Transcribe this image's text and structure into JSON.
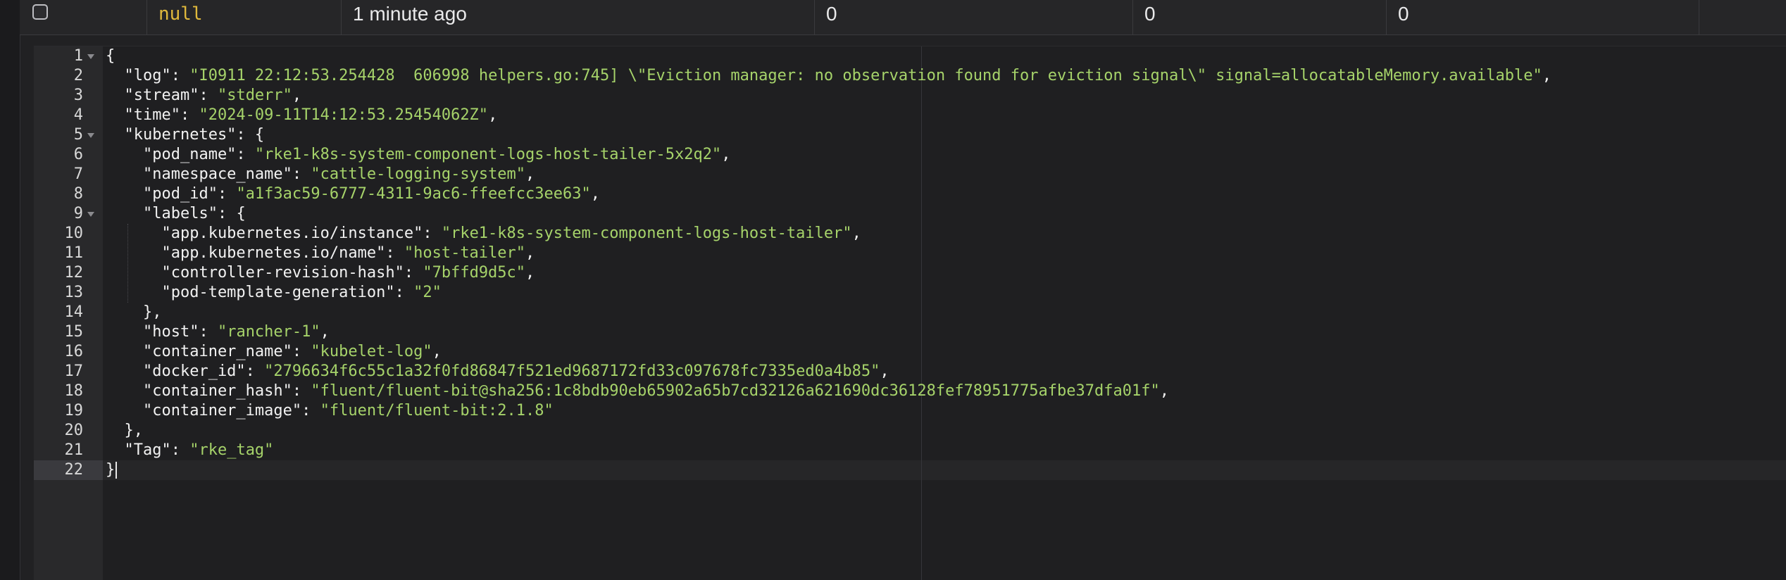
{
  "row": {
    "null_value": "null",
    "time_ago": "1 minute ago",
    "col_a": "0",
    "col_b": "0",
    "col_c": "0"
  },
  "editor": {
    "lines": [
      {
        "num": "1",
        "key": "",
        "punct_pre": "{",
        "value": "",
        "punct_post": ""
      },
      {
        "num": "2",
        "key": "  \"log\": ",
        "punct_pre": "",
        "value": "\"I0911 22:12:53.254428  606998 helpers.go:745] \\\"Eviction manager: no observation found for eviction signal\\\" signal=allocatableMemory.available\"",
        "punct_post": ","
      },
      {
        "num": "3",
        "key": "  \"stream\": ",
        "punct_pre": "",
        "value": "\"stderr\"",
        "punct_post": ","
      },
      {
        "num": "4",
        "key": "  \"time\": ",
        "punct_pre": "",
        "value": "\"2024-09-11T14:12:53.25454062Z\"",
        "punct_post": ","
      },
      {
        "num": "5",
        "key": "  \"kubernetes\": ",
        "punct_pre": "",
        "value": "",
        "punct_post": "{"
      },
      {
        "num": "6",
        "key": "    \"pod_name\": ",
        "punct_pre": "",
        "value": "\"rke1-k8s-system-component-logs-host-tailer-5x2q2\"",
        "punct_post": ","
      },
      {
        "num": "7",
        "key": "    \"namespace_name\": ",
        "punct_pre": "",
        "value": "\"cattle-logging-system\"",
        "punct_post": ","
      },
      {
        "num": "8",
        "key": "    \"pod_id\": ",
        "punct_pre": "",
        "value": "\"a1f3ac59-6777-4311-9ac6-ffeefcc3ee63\"",
        "punct_post": ","
      },
      {
        "num": "9",
        "key": "    \"labels\": ",
        "punct_pre": "",
        "value": "",
        "punct_post": "{"
      },
      {
        "num": "10",
        "key": "      \"app.kubernetes.io/instance\": ",
        "punct_pre": "",
        "value": "\"rke1-k8s-system-component-logs-host-tailer\"",
        "punct_post": ","
      },
      {
        "num": "11",
        "key": "      \"app.kubernetes.io/name\": ",
        "punct_pre": "",
        "value": "\"host-tailer\"",
        "punct_post": ","
      },
      {
        "num": "12",
        "key": "      \"controller-revision-hash\": ",
        "punct_pre": "",
        "value": "\"7bffd9d5c\"",
        "punct_post": ","
      },
      {
        "num": "13",
        "key": "      \"pod-template-generation\": ",
        "punct_pre": "",
        "value": "\"2\"",
        "punct_post": ""
      },
      {
        "num": "14",
        "key": "    ",
        "punct_pre": "",
        "value": "",
        "punct_post": "},"
      },
      {
        "num": "15",
        "key": "    \"host\": ",
        "punct_pre": "",
        "value": "\"rancher-1\"",
        "punct_post": ","
      },
      {
        "num": "16",
        "key": "    \"container_name\": ",
        "punct_pre": "",
        "value": "\"kubelet-log\"",
        "punct_post": ","
      },
      {
        "num": "17",
        "key": "    \"docker_id\": ",
        "punct_pre": "",
        "value": "\"2796634f6c55c1a32f0fd86847f521ed9687172fd33c097678fc7335ed0a4b85\"",
        "punct_post": ","
      },
      {
        "num": "18",
        "key": "    \"container_hash\": ",
        "punct_pre": "",
        "value": "\"fluent/fluent-bit@sha256:1c8bdb90eb65902a65b7cd32126a621690dc36128fef78951775afbe37dfa01f\"",
        "punct_post": ","
      },
      {
        "num": "19",
        "key": "    \"container_image\": ",
        "punct_pre": "",
        "value": "\"fluent/fluent-bit:2.1.8\"",
        "punct_post": ""
      },
      {
        "num": "20",
        "key": "  ",
        "punct_pre": "",
        "value": "",
        "punct_post": "},"
      },
      {
        "num": "21",
        "key": "  \"Tag\": ",
        "punct_pre": "",
        "value": "\"rke_tag\"",
        "punct_post": ""
      },
      {
        "num": "22",
        "key": "",
        "punct_pre": "}",
        "value": "",
        "punct_post": ""
      }
    ]
  }
}
